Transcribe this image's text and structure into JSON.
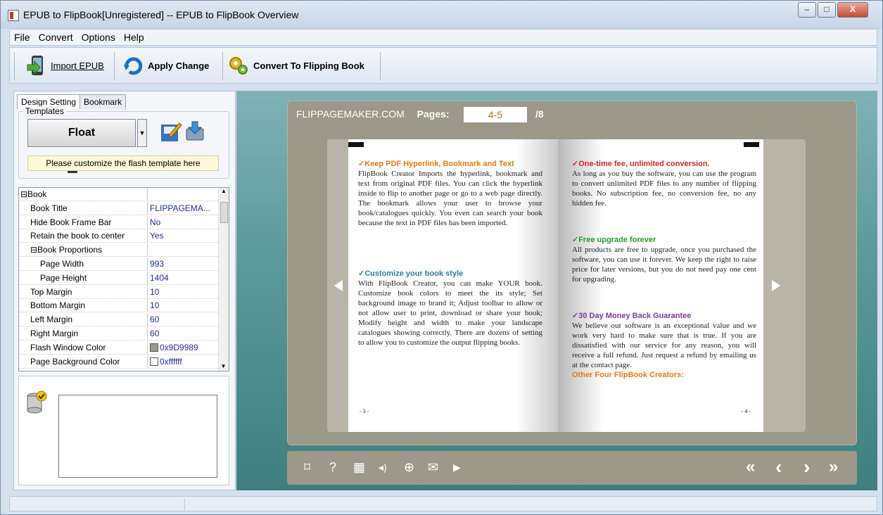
{
  "window": {
    "title": "EPUB to FlipBook[Unregistered] -- EPUB to FlipBook Overview"
  },
  "menu": [
    "File",
    "Convert",
    "Options",
    "Help"
  ],
  "toolbar": {
    "import_label": "Import EPUB",
    "apply_label": "Apply Change",
    "convert_label": "Convert To Flipping Book"
  },
  "tabs": [
    "Design Setting",
    "Bookmark"
  ],
  "templates": {
    "group_label": "Templates",
    "template_name": "Float",
    "hint": "Please customize the flash template here"
  },
  "properties": [
    {
      "key": "⊟Book",
      "value": "",
      "indent": 0
    },
    {
      "key": "Book Title",
      "value": "FLIPPAGEMA...",
      "indent": 1
    },
    {
      "key": "Hide Book Frame Bar",
      "value": "No",
      "indent": 1
    },
    {
      "key": "Retain the book to center",
      "value": "Yes",
      "indent": 1
    },
    {
      "key": "⊟Book Proportions",
      "value": "",
      "indent": 1
    },
    {
      "key": "Page Width",
      "value": "993",
      "indent": 2
    },
    {
      "key": "Page Height",
      "value": "1404",
      "indent": 2
    },
    {
      "key": "Top Margin",
      "value": "10",
      "indent": 1
    },
    {
      "key": "Bottom Margin",
      "value": "10",
      "indent": 1
    },
    {
      "key": "Left Margin",
      "value": "60",
      "indent": 1
    },
    {
      "key": "Right Margin",
      "value": "60",
      "indent": 1
    },
    {
      "key": "Flash Window Color",
      "value": "0x9D9989",
      "indent": 1,
      "swatch": "#9D9989"
    },
    {
      "key": "Page Background Color",
      "value": "0xffffff",
      "indent": 1,
      "swatch": "#ffffff"
    }
  ],
  "viewer": {
    "site": "FLIPPAGEMAKER.COM",
    "pages_label": "Pages:",
    "pages_value": "4-5",
    "pages_total": "/8",
    "left_page": {
      "sections": [
        {
          "heading": "✓Keep PDF Hyperlink, Bookmark and Text",
          "color": "#e87a12",
          "text": "FlipBook Creator Imports the hyperlink, bookmark and text from original PDF files. You can click the hyperlink inside to flip to another page or go to a web page directly. The bookmark allows your user to browse your book/catalogues quickly. You even can search your book because the text in PDF files has been imported."
        },
        {
          "heading": "✓Customize your book style",
          "color": "#2a7fa8",
          "text": "With FlipBook Creator, you can make YOUR book. Customize book colors to meet the its style; Set background image to brand it; Adjust toolbar to allow or not allow user to print, download or share your book; Modify height and width to make your landscape catalogues showing correctly. There are dozens of setting to allow you to customize the output flipping books."
        }
      ],
      "page_number": "- 3 -"
    },
    "right_page": {
      "sections": [
        {
          "heading": "✓One-time fee, unlimited conversion.",
          "color": "#d0281e",
          "text": "As long as you buy the software, you can use the program to convert unlimited PDF files to any number of flipping books. No subscription fee, no conversion fee, no any hidden fee."
        },
        {
          "heading": "✓Free upgrade forever",
          "color": "#2a9a2a",
          "text": "All products are free to upgrade, once you purchased the software, you can use it forever. We keep the right to raise price for later versions, but you do not need pay one cent for upgrading."
        },
        {
          "heading": "✓30 Day Money Back Guarantee",
          "color": "#7a3aa8",
          "text": "We believe our software is an exceptional value and we work very hard to make sure that is true. If you are dissatisfied with our service for any reason, you will receive a full refund. Just request a refund by emailing us at the contact page."
        }
      ],
      "footer_heading": "Other Four FlipBook Creators:",
      "footer_color": "#e87a12",
      "page_number": "- 4 -"
    },
    "controls": {
      "fullscreen": "⌑",
      "help": "?",
      "thumbnails": "▦",
      "sound": "◂)",
      "zoom": "⊕",
      "email": "✉",
      "play": "▶",
      "first": "«",
      "prev": "‹",
      "next": "›",
      "last": "»"
    }
  }
}
